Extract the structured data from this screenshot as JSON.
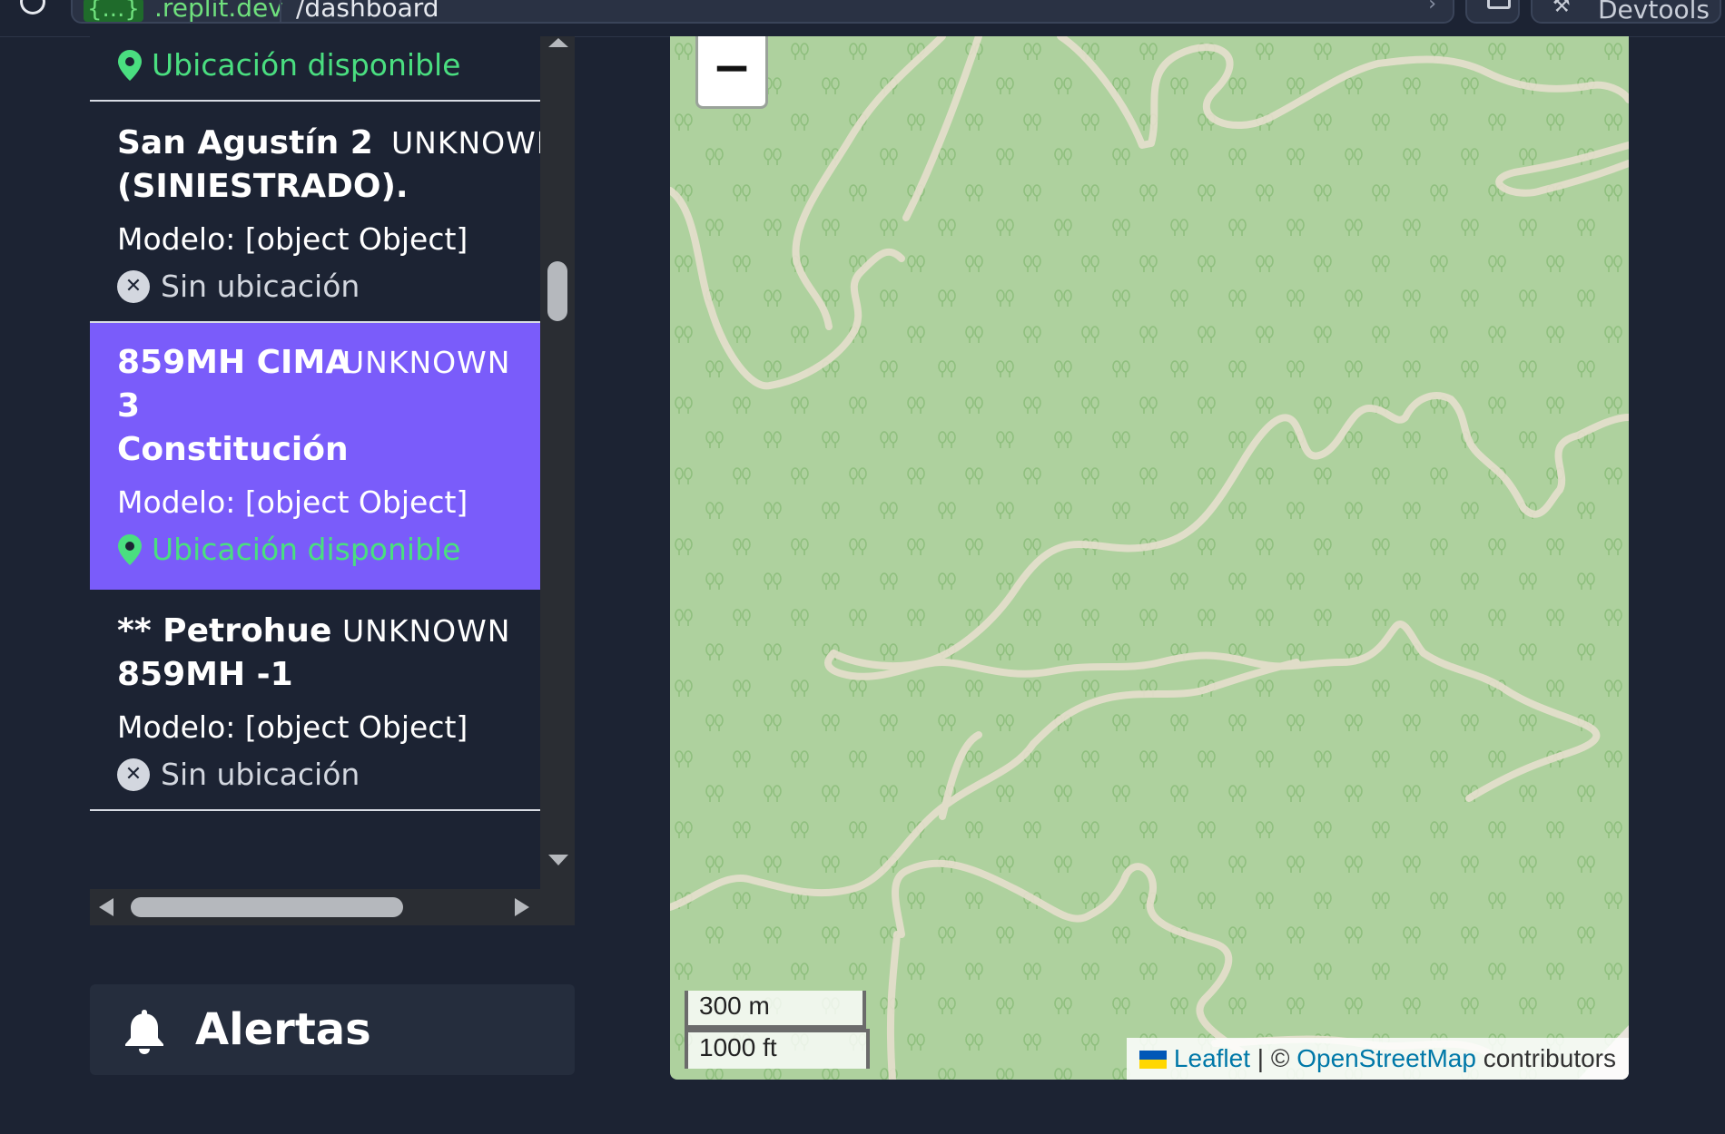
{
  "browser": {
    "url_subdomain": "{...}",
    "url_domain": ".replit.dev",
    "url_path": "/dashboard",
    "devtools_label": "Devtools"
  },
  "vehicle_list": [
    {
      "name": "",
      "status": "",
      "model": "Modelo: [object Object]",
      "location": "Ubicación disponible",
      "has_location": true,
      "selected": false
    },
    {
      "name": "San Agustín 2\n(SINIESTRADO).",
      "status": "UNKNOWN",
      "model": "Modelo: [object Object]",
      "location": "Sin ubicación",
      "has_location": false,
      "selected": false
    },
    {
      "name": "859MH CIMA\n3\nConstitución",
      "status": "UNKNOWN",
      "model": "Modelo: [object Object]",
      "location": "Ubicación disponible",
      "has_location": true,
      "selected": true
    },
    {
      "name": "** Petrohue\n859MH -1",
      "status": "UNKNOWN",
      "model": "Modelo: [object Object]",
      "location": "Sin ubicación",
      "has_location": false,
      "selected": false
    }
  ],
  "alerts": {
    "title": "Alertas",
    "icon": "bell-icon"
  },
  "map": {
    "zoom_out_label": "−",
    "scale_metric": "300 m",
    "scale_imperial": "1000 ft",
    "attribution": {
      "leaflet": "Leaflet",
      "separator": "| ©",
      "osm": "OpenStreetMap",
      "suffix": "contributors"
    }
  },
  "colors": {
    "page_bg": "#1c2333",
    "selected_item": "#7a5cfa",
    "location_ok": "#4ade80",
    "map_forest": "#aed19e",
    "map_track": "#e8e0cf"
  }
}
